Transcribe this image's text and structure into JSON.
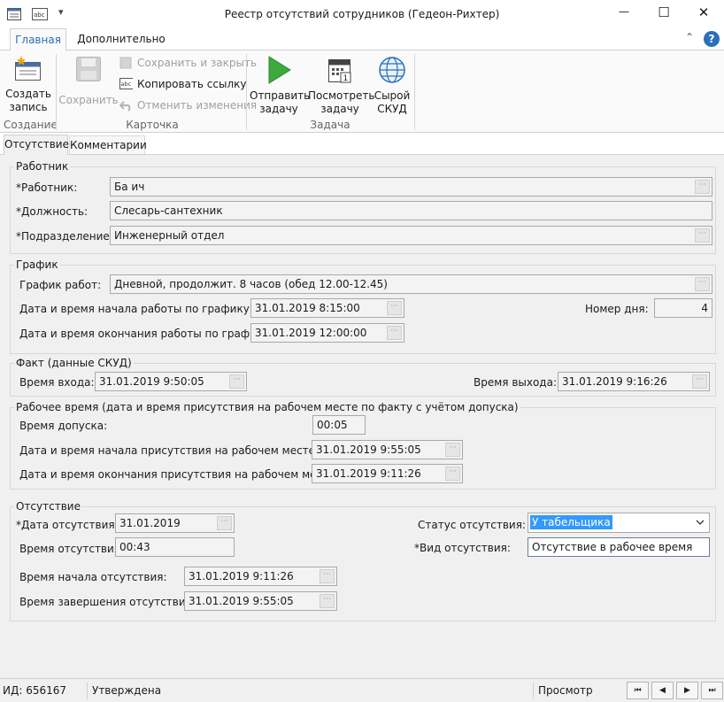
{
  "window": {
    "title": "Реестр отсутствий сотрудников (Гедеон-Рихтер)",
    "minimize_glyph": "—",
    "maximize_glyph": "☐",
    "close_glyph": "✕",
    "qat_dropdown_glyph": "▾"
  },
  "ribbon_tabs": [
    {
      "label": "Главная"
    },
    {
      "label": "Дополнительно"
    }
  ],
  "ribbon_right": {
    "collapse_glyph": "⌃",
    "help_glyph": "?"
  },
  "ribbon": {
    "create": {
      "line1": "Создать",
      "line2": "запись"
    },
    "save": {
      "label": "Сохранить"
    },
    "save_close": {
      "label": "Сохранить и закрыть"
    },
    "copy_link": {
      "label": "Копировать ссылку"
    },
    "undo": {
      "label": "Отменить изменения"
    },
    "send": {
      "line1": "Отправить",
      "line2": "задачу"
    },
    "view": {
      "line1": "Посмотреть",
      "line2": "задачу"
    },
    "raw": {
      "line1": "Сырой",
      "line2": "СКУД"
    },
    "groups": {
      "create": "Создание",
      "card": "Карточка",
      "task": "Задача"
    }
  },
  "tabs": [
    {
      "label": "Отсутствие"
    },
    {
      "label": "Комментарии"
    }
  ],
  "worker": {
    "legend": "Работник",
    "employee_label": "*Работник:",
    "employee_value": "Ба                    ич",
    "position_label": "*Должность:",
    "position_value": "Слесарь-сантехник",
    "dept_label": "*Подразделение:",
    "dept_value": "Инженерный отдел"
  },
  "schedule": {
    "legend": "График",
    "schedule_label": "График работ:",
    "schedule_value": "Дневной, продолжит. 8 часов (обед 12.00-12.45)",
    "start_label": "Дата и время начала работы по графику:",
    "start_value": "31.01.2019 8:15:00",
    "end_label": "Дата и время окончания работы по графику:",
    "end_value": "31.01.2019 12:00:00",
    "day_label": "Номер дня:",
    "day_value": "4"
  },
  "skud": {
    "legend": "Факт (данные СКУД)",
    "in_label": "Время входа:",
    "in_value": "31.01.2019 9:50:05",
    "out_label": "Время выхода:",
    "out_value": "31.01.2019 9:16:26"
  },
  "worktime": {
    "legend": "Рабочее время (дата и время присутствия на рабочем месте по факту с учётом допуска)",
    "tol_label": "Время допуска:",
    "tol_value": "00:05",
    "start_label": "Дата и время начала присутствия на рабочем месте:",
    "start_value": "31.01.2019 9:55:05",
    "end_label": "Дата и время окончания присутствия на рабочем месте:",
    "end_value": "31.01.2019 9:11:26"
  },
  "absence": {
    "legend": "Отсутствие",
    "date_label": "*Дата отсутствия:",
    "date_value": "31.01.2019",
    "dur_label": "Время отсутствия:",
    "dur_value": "00:43",
    "start_label": "Время начала отсутствия:",
    "start_value": "31.01.2019 9:11:26",
    "end_label": "Время завершения отсутствия:",
    "end_value": "31.01.2019 9:55:05",
    "status_label": "Статус отсутствия:",
    "status_value": "У табельщика",
    "type_label": "*Вид отсутствия:",
    "type_value": "Отсутствие в рабочее время"
  },
  "statusbar": {
    "id": "ИД: 656167",
    "state": "Утверждена",
    "mode": "Просмотр",
    "first": "⏮",
    "prev": "◀",
    "next": "▶",
    "last": "⏭"
  },
  "dots_glyph": "···",
  "colors": {
    "accent": "#2b6fb8",
    "selection": "#3399ff"
  }
}
